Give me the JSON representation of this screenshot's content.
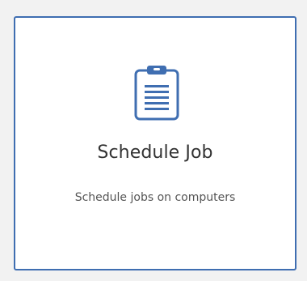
{
  "card": {
    "title": "Schedule Job",
    "description": "Schedule jobs on computers",
    "icon": "clipboard-icon"
  },
  "colors": {
    "accent": "#3f6eb1",
    "background": "#f2f2f2",
    "card": "#ffffff",
    "title_text": "#333333",
    "description_text": "#555555"
  }
}
